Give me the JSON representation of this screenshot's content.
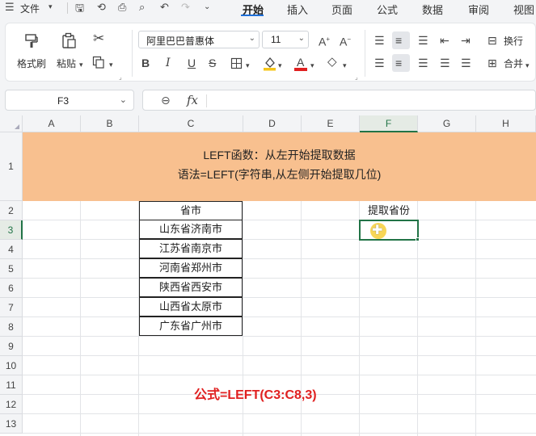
{
  "menubar": {
    "file_label": "文件",
    "tabs": [
      "开始",
      "插入",
      "页面",
      "公式",
      "数据",
      "审阅",
      "视图"
    ],
    "active_tab": "开始"
  },
  "ribbon": {
    "format_painter": "格式刷",
    "paste": "粘贴",
    "font_name": "阿里巴巴普惠体",
    "font_size": "11",
    "wrap": "换行",
    "merge": "合并",
    "accent_red": "#e02020",
    "accent_yellow": "#f5c518"
  },
  "formula_bar": {
    "name_box": "F3",
    "fx": "fx",
    "formula": ""
  },
  "grid": {
    "columns": [
      "A",
      "B",
      "C",
      "D",
      "E",
      "F",
      "G",
      "H"
    ],
    "selected_column": "F",
    "rows": [
      "1",
      "2",
      "3",
      "4",
      "5",
      "6",
      "7",
      "8",
      "9",
      "10",
      "11",
      "12",
      "13"
    ],
    "selected_row": "3",
    "banner_line1": "LEFT函数：从左开始提取数据",
    "banner_line2": "语法=LEFT(字符串,从左侧开始提取几位)",
    "banner_color": "#f8c08f",
    "table_header": "省市",
    "table_values": [
      "山东省济南市",
      "江苏省南京市",
      "河南省郑州市",
      "陕西省西安市",
      "山西省太原市",
      "广东省广州市"
    ],
    "f2_label": "提取省份",
    "formula_note": "公式=LEFT(C3:C8,3)"
  }
}
